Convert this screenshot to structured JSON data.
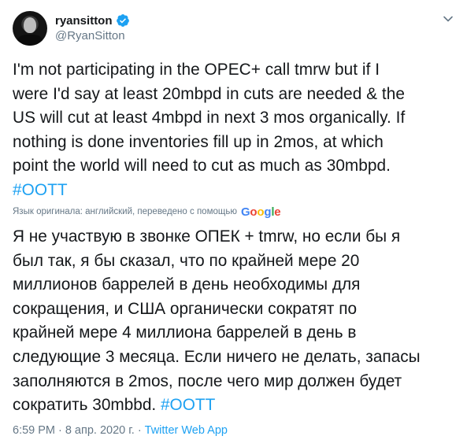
{
  "author": {
    "display_name": "ryansitton",
    "handle": "@RyanSitton",
    "verified": true,
    "avatar_icon": "user-avatar-photo"
  },
  "tweet": {
    "text_lines": [
      "I'm not participating in the OPEC+ call tmrw but if I",
      "were I'd say at least 20mbpd in cuts are needed & the",
      "US will cut at least 4mbpd in next 3 mos organically. If",
      "nothing is done inventories fill up in 2mos, at which",
      "point the world will need to cut as much as 30mbpd."
    ],
    "hashtag": "#OOTT"
  },
  "translation": {
    "note": "Язык оригинала: английский, переведено с помощью",
    "provider": "Google",
    "text_lines": [
      "Я не участвую в звонке ОПЕК + tmrw, но если бы я",
      "был так, я бы сказал, что по крайней мере 20",
      "миллионов баррелей в день необходимы для",
      "сокращения, и США органически сократят по",
      "крайней мере 4 миллиона баррелей в день в",
      "следующие 3 месяца. Если ничего не делать, запасы",
      "заполняются в 2mos, после чего мир должен будет"
    ],
    "last_line_prefix": "сократить 30mbbd. ",
    "hashtag": "#OOTT"
  },
  "meta": {
    "time": "6:59 PM",
    "separator": "·",
    "date": "8 апр. 2020 г.",
    "source": "Twitter Web App"
  },
  "colors": {
    "link": "#1da1f2",
    "muted": "#657786",
    "text": "#14171a"
  }
}
